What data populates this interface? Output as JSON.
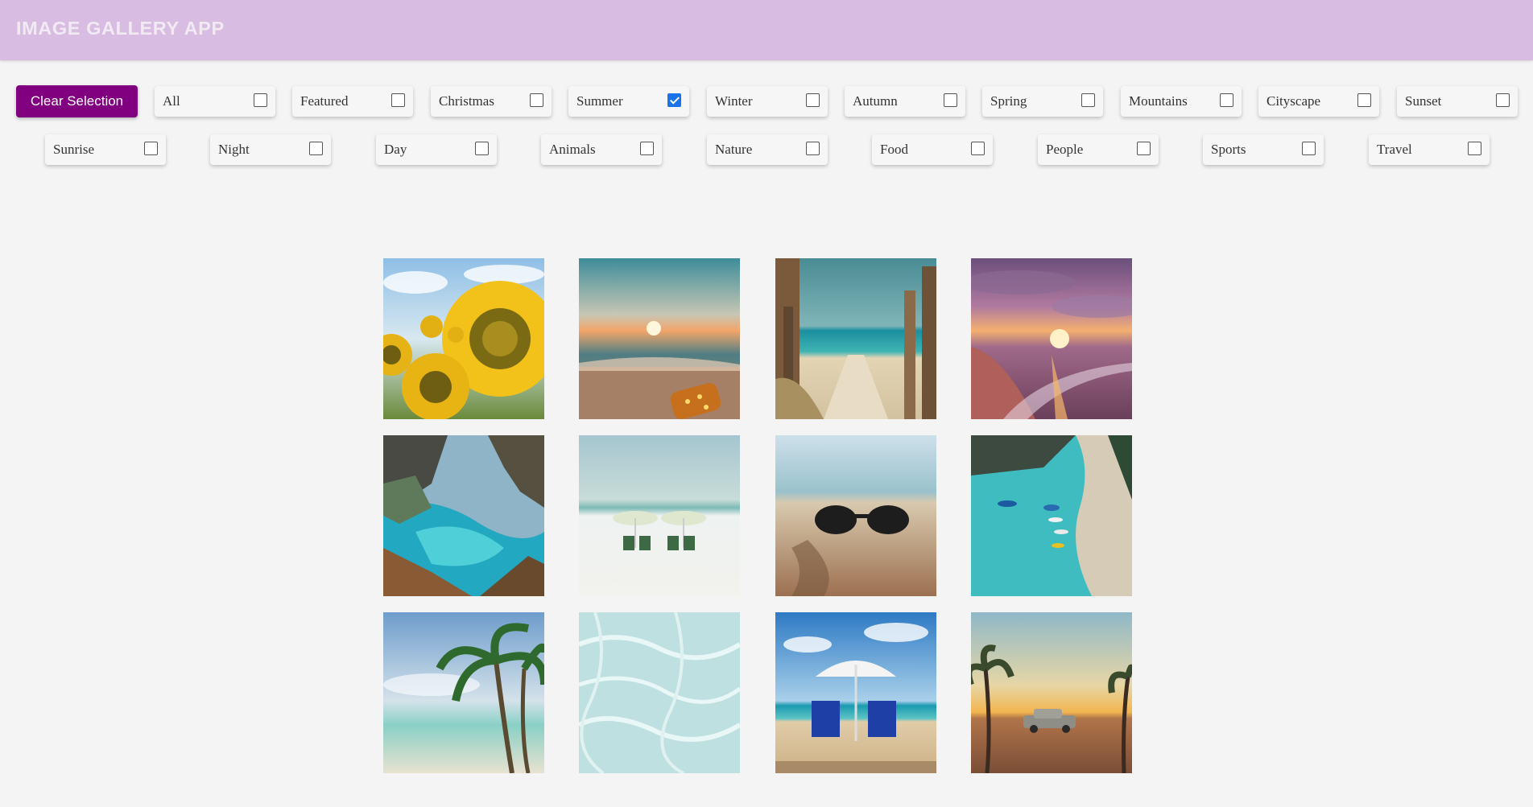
{
  "header": {
    "title": "IMAGE GALLERY APP"
  },
  "toolbar": {
    "clear_label": "Clear Selection"
  },
  "filters": [
    {
      "label": "All",
      "checked": false
    },
    {
      "label": "Featured",
      "checked": false
    },
    {
      "label": "Christmas",
      "checked": false
    },
    {
      "label": "Summer",
      "checked": true
    },
    {
      "label": "Winter",
      "checked": false
    },
    {
      "label": "Autumn",
      "checked": false
    },
    {
      "label": "Spring",
      "checked": false
    },
    {
      "label": "Mountains",
      "checked": false
    },
    {
      "label": "Cityscape",
      "checked": false
    },
    {
      "label": "Sunset",
      "checked": false
    },
    {
      "label": "Sunrise",
      "checked": false
    },
    {
      "label": "Night",
      "checked": false
    },
    {
      "label": "Day",
      "checked": false
    },
    {
      "label": "Animals",
      "checked": false
    },
    {
      "label": "Nature",
      "checked": false
    },
    {
      "label": "Food",
      "checked": false
    },
    {
      "label": "People",
      "checked": false
    },
    {
      "label": "Sports",
      "checked": false
    },
    {
      "label": "Travel",
      "checked": false
    }
  ],
  "colors": {
    "header_bg": "#d8bce2",
    "accent": "#800080",
    "checkbox_checked": "#1a73e8"
  },
  "gallery": {
    "images": [
      {
        "subject": "sunflowers"
      },
      {
        "subject": "beach-sunset-jar"
      },
      {
        "subject": "beach-boardwalk"
      },
      {
        "subject": "purple-sunset-beach"
      },
      {
        "subject": "coastal-cove"
      },
      {
        "subject": "beach-umbrellas"
      },
      {
        "subject": "sunglasses-sand"
      },
      {
        "subject": "aerial-beach-boats"
      },
      {
        "subject": "palm-trees-beach"
      },
      {
        "subject": "clear-water"
      },
      {
        "subject": "umbrella-chairs-beach"
      },
      {
        "subject": "car-desert-sunset"
      }
    ]
  }
}
